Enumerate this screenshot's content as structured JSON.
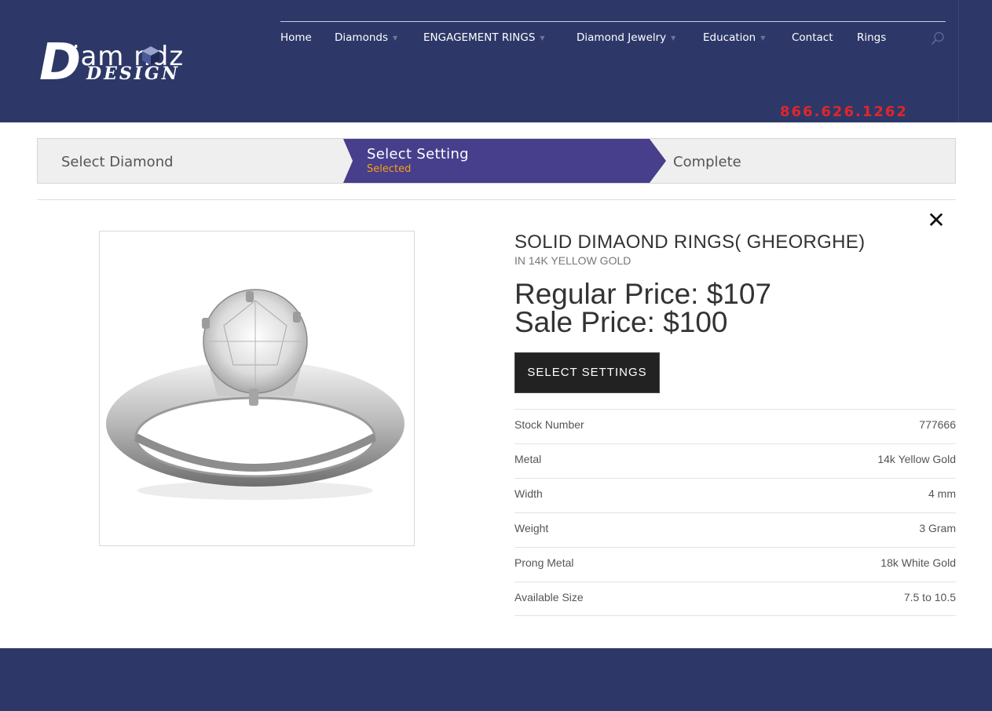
{
  "brand": {
    "logo_letter": "D",
    "logo_main": "iam ndz",
    "logo_sub": "DESIGN"
  },
  "nav": {
    "items": [
      {
        "label": "Home",
        "has_dropdown": false
      },
      {
        "label": "Diamonds",
        "has_dropdown": true
      },
      {
        "label": "ENGAGEMENT RINGS",
        "has_dropdown": true
      },
      {
        "label": "Diamond Jewelry",
        "has_dropdown": true
      },
      {
        "label": "Education",
        "has_dropdown": true
      },
      {
        "label": "Contact",
        "has_dropdown": false
      },
      {
        "label": "Rings",
        "has_dropdown": false
      }
    ],
    "search_icon": "search-icon"
  },
  "phone": "866.626.1262",
  "steps": {
    "step1": "Select Diamond",
    "step2_title": "Select Setting",
    "step2_status": "Selected",
    "step3": "Complete"
  },
  "product": {
    "title": "SOLID DIMAOND RINGS( GHEORGHE)",
    "subtitle": "IN 14K YELLOW GOLD",
    "regular_price": "Regular Price: $107",
    "sale_price": "Sale Price: $100",
    "cta": "SELECT SETTINGS",
    "close_icon": "close-icon",
    "specs": [
      {
        "label": "Stock Number",
        "value": "777666"
      },
      {
        "label": "Metal",
        "value": "14k Yellow Gold"
      },
      {
        "label": "Width",
        "value": "4 mm"
      },
      {
        "label": "Weight",
        "value": "3 Gram"
      },
      {
        "label": "Prong Metal",
        "value": "18k White Gold"
      },
      {
        "label": "Available Size",
        "value": "7.5 to 10.5"
      }
    ]
  },
  "colors": {
    "header_bg": "#2d3868",
    "active_step": "#473e8c",
    "step_status": "#f7a11a",
    "phone": "#e0262a",
    "button_bg": "#222222"
  }
}
